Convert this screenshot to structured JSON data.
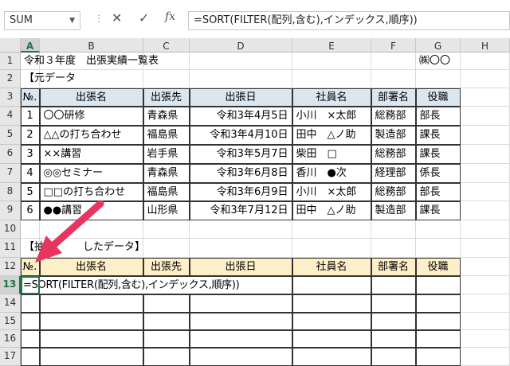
{
  "formula_bar": {
    "name_box": "SUM",
    "cancel_icon": "✕",
    "enter_icon": "✓",
    "fx_label": "fx",
    "formula": "=SORT(FILTER(配列,含む),インデックス,順序))"
  },
  "columns": [
    "A",
    "B",
    "C",
    "D",
    "E",
    "F",
    "G",
    "H"
  ],
  "rows": [
    "1",
    "2",
    "3",
    "4",
    "5",
    "6",
    "7",
    "8",
    "9",
    "10",
    "11",
    "12",
    "13",
    "14",
    "15",
    "16",
    "17"
  ],
  "title": "令和３年度　出張実績一覧表",
  "company": "㈱〇〇",
  "source_label": "【元データ",
  "extract_label_left": "【抽",
  "extract_label_right": "したデータ】",
  "headers": [
    "№.",
    "出張名",
    "出張先",
    "出張日",
    "社員名",
    "部署名",
    "役職"
  ],
  "table": [
    [
      "1",
      "〇〇研修",
      "青森県",
      "令和3年4月5日",
      "小川　×太郎",
      "総務部",
      "部長"
    ],
    [
      "2",
      "△△の打ち合わせ",
      "福島県",
      "令和3年4月10日",
      "田中　△ノ助",
      "製造部",
      "課長"
    ],
    [
      "3",
      "××講習",
      "岩手県",
      "令和3年5月7日",
      "柴田　□",
      "総務部",
      "課長"
    ],
    [
      "4",
      "◎◎セミナー",
      "青森県",
      "令和3年6月8日",
      "香川　●次",
      "経理部",
      "係長"
    ],
    [
      "5",
      "□□の打ち合わせ",
      "福島県",
      "令和3年6月9日",
      "小川　×太郎",
      "総務部",
      "部長"
    ],
    [
      "6",
      "●●講習",
      "山形県",
      "令和3年7月12日",
      "田中　△ノ助",
      "製造部",
      "課長"
    ]
  ],
  "editing_cell": "=SORT(FILTER(配列,含む),インデックス,順序))",
  "colors": {
    "header_blue": "#dce6f1",
    "header_yellow": "#fdefc7",
    "arrow": "#e8355f",
    "selection": "#217346"
  }
}
